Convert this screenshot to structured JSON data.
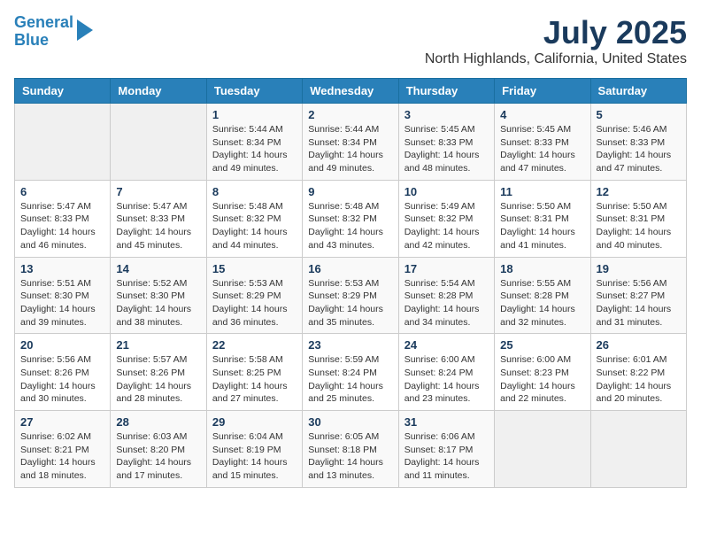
{
  "header": {
    "logo_line1": "General",
    "logo_line2": "Blue",
    "month": "July 2025",
    "location": "North Highlands, California, United States"
  },
  "weekdays": [
    "Sunday",
    "Monday",
    "Tuesday",
    "Wednesday",
    "Thursday",
    "Friday",
    "Saturday"
  ],
  "weeks": [
    [
      {
        "day": "",
        "info": ""
      },
      {
        "day": "",
        "info": ""
      },
      {
        "day": "1",
        "info": "Sunrise: 5:44 AM\nSunset: 8:34 PM\nDaylight: 14 hours and 49 minutes."
      },
      {
        "day": "2",
        "info": "Sunrise: 5:44 AM\nSunset: 8:34 PM\nDaylight: 14 hours and 49 minutes."
      },
      {
        "day": "3",
        "info": "Sunrise: 5:45 AM\nSunset: 8:33 PM\nDaylight: 14 hours and 48 minutes."
      },
      {
        "day": "4",
        "info": "Sunrise: 5:45 AM\nSunset: 8:33 PM\nDaylight: 14 hours and 47 minutes."
      },
      {
        "day": "5",
        "info": "Sunrise: 5:46 AM\nSunset: 8:33 PM\nDaylight: 14 hours and 47 minutes."
      }
    ],
    [
      {
        "day": "6",
        "info": "Sunrise: 5:47 AM\nSunset: 8:33 PM\nDaylight: 14 hours and 46 minutes."
      },
      {
        "day": "7",
        "info": "Sunrise: 5:47 AM\nSunset: 8:33 PM\nDaylight: 14 hours and 45 minutes."
      },
      {
        "day": "8",
        "info": "Sunrise: 5:48 AM\nSunset: 8:32 PM\nDaylight: 14 hours and 44 minutes."
      },
      {
        "day": "9",
        "info": "Sunrise: 5:48 AM\nSunset: 8:32 PM\nDaylight: 14 hours and 43 minutes."
      },
      {
        "day": "10",
        "info": "Sunrise: 5:49 AM\nSunset: 8:32 PM\nDaylight: 14 hours and 42 minutes."
      },
      {
        "day": "11",
        "info": "Sunrise: 5:50 AM\nSunset: 8:31 PM\nDaylight: 14 hours and 41 minutes."
      },
      {
        "day": "12",
        "info": "Sunrise: 5:50 AM\nSunset: 8:31 PM\nDaylight: 14 hours and 40 minutes."
      }
    ],
    [
      {
        "day": "13",
        "info": "Sunrise: 5:51 AM\nSunset: 8:30 PM\nDaylight: 14 hours and 39 minutes."
      },
      {
        "day": "14",
        "info": "Sunrise: 5:52 AM\nSunset: 8:30 PM\nDaylight: 14 hours and 38 minutes."
      },
      {
        "day": "15",
        "info": "Sunrise: 5:53 AM\nSunset: 8:29 PM\nDaylight: 14 hours and 36 minutes."
      },
      {
        "day": "16",
        "info": "Sunrise: 5:53 AM\nSunset: 8:29 PM\nDaylight: 14 hours and 35 minutes."
      },
      {
        "day": "17",
        "info": "Sunrise: 5:54 AM\nSunset: 8:28 PM\nDaylight: 14 hours and 34 minutes."
      },
      {
        "day": "18",
        "info": "Sunrise: 5:55 AM\nSunset: 8:28 PM\nDaylight: 14 hours and 32 minutes."
      },
      {
        "day": "19",
        "info": "Sunrise: 5:56 AM\nSunset: 8:27 PM\nDaylight: 14 hours and 31 minutes."
      }
    ],
    [
      {
        "day": "20",
        "info": "Sunrise: 5:56 AM\nSunset: 8:26 PM\nDaylight: 14 hours and 30 minutes."
      },
      {
        "day": "21",
        "info": "Sunrise: 5:57 AM\nSunset: 8:26 PM\nDaylight: 14 hours and 28 minutes."
      },
      {
        "day": "22",
        "info": "Sunrise: 5:58 AM\nSunset: 8:25 PM\nDaylight: 14 hours and 27 minutes."
      },
      {
        "day": "23",
        "info": "Sunrise: 5:59 AM\nSunset: 8:24 PM\nDaylight: 14 hours and 25 minutes."
      },
      {
        "day": "24",
        "info": "Sunrise: 6:00 AM\nSunset: 8:24 PM\nDaylight: 14 hours and 23 minutes."
      },
      {
        "day": "25",
        "info": "Sunrise: 6:00 AM\nSunset: 8:23 PM\nDaylight: 14 hours and 22 minutes."
      },
      {
        "day": "26",
        "info": "Sunrise: 6:01 AM\nSunset: 8:22 PM\nDaylight: 14 hours and 20 minutes."
      }
    ],
    [
      {
        "day": "27",
        "info": "Sunrise: 6:02 AM\nSunset: 8:21 PM\nDaylight: 14 hours and 18 minutes."
      },
      {
        "day": "28",
        "info": "Sunrise: 6:03 AM\nSunset: 8:20 PM\nDaylight: 14 hours and 17 minutes."
      },
      {
        "day": "29",
        "info": "Sunrise: 6:04 AM\nSunset: 8:19 PM\nDaylight: 14 hours and 15 minutes."
      },
      {
        "day": "30",
        "info": "Sunrise: 6:05 AM\nSunset: 8:18 PM\nDaylight: 14 hours and 13 minutes."
      },
      {
        "day": "31",
        "info": "Sunrise: 6:06 AM\nSunset: 8:17 PM\nDaylight: 14 hours and 11 minutes."
      },
      {
        "day": "",
        "info": ""
      },
      {
        "day": "",
        "info": ""
      }
    ]
  ]
}
